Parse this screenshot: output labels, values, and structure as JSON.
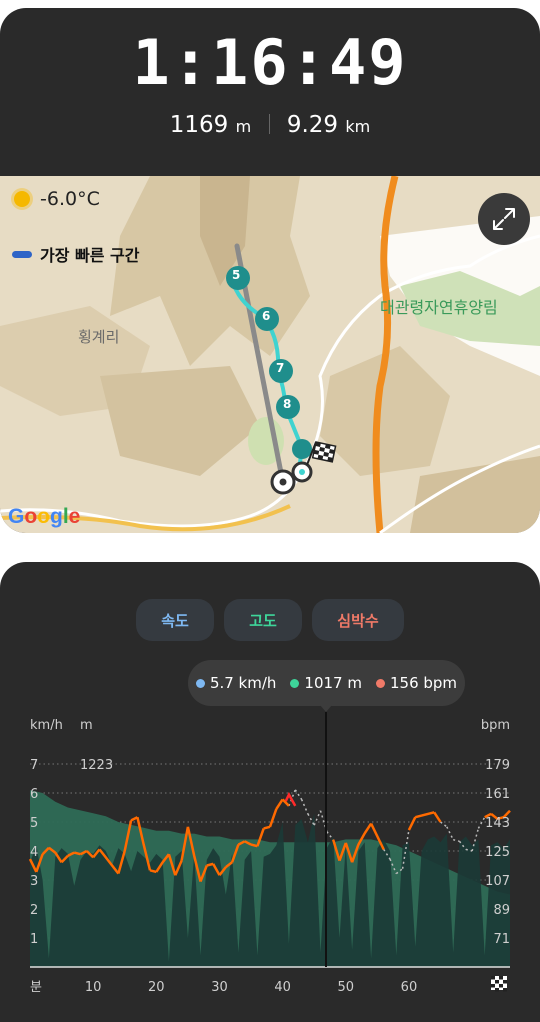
{
  "workout": {
    "duration": "1:16:49",
    "elevation_value": "1169",
    "elevation_unit": "m",
    "distance_value": "9.29",
    "distance_unit": "km"
  },
  "map": {
    "temperature": "-6.0°C",
    "legend_label": "가장 빠른 구간",
    "place_1": "대관령자연휴양림",
    "place_2": "횡계리",
    "attribution": "Google",
    "markers": [
      "5",
      "6",
      "7",
      "8"
    ],
    "route_color": "#3fd3d0",
    "fastest_color": "#2e64c7"
  },
  "chart_tabs": [
    {
      "label": "속도",
      "color": "#7eb8f2"
    },
    {
      "label": "고도",
      "color": "#3ed59a"
    },
    {
      "label": "심박수",
      "color": "#f07a68"
    }
  ],
  "tooltip": {
    "speed": "5.7 km/h",
    "altitude": "1017 m",
    "heart_rate": "156 bpm"
  },
  "chart_data": {
    "type": "area",
    "xlabel": "분",
    "x_ticks": [
      "10",
      "20",
      "30",
      "40",
      "50",
      "60"
    ],
    "xlim": [
      0,
      76
    ],
    "y_left_unit": "km/h",
    "y_left_ticks": [
      "7",
      "6",
      "5",
      "4",
      "3",
      "2",
      "1"
    ],
    "y_left_range": [
      0,
      7
    ],
    "y_altitude_unit": "m",
    "y_altitude_ticks": [
      "1223"
    ],
    "y_right_unit": "bpm",
    "y_right_ticks": [
      "179",
      "161",
      "143",
      "125",
      "107",
      "89",
      "71"
    ],
    "y_right_range": [
      53,
      179
    ],
    "series": [
      {
        "name": "고도",
        "color": "#3ed59a",
        "x": [
          0,
          2,
          4,
          6,
          8,
          10,
          12,
          14,
          16,
          18,
          20,
          22,
          24,
          26,
          28,
          30,
          32,
          34,
          36,
          38,
          40,
          42,
          44,
          46,
          48,
          50,
          52,
          54,
          56,
          58,
          60,
          62,
          64,
          66,
          68,
          70,
          72,
          74,
          76
        ],
        "values": [
          6.1,
          6.0,
          5.7,
          5.5,
          5.4,
          5.3,
          5.2,
          5.0,
          4.9,
          4.8,
          4.7,
          4.7,
          4.6,
          4.6,
          4.5,
          4.5,
          4.4,
          4.4,
          4.4,
          4.3,
          4.3,
          4.3,
          4.3,
          4.3,
          4.3,
          4.4,
          4.4,
          4.4,
          4.3,
          4.2,
          4.0,
          3.8,
          3.6,
          3.4,
          3.2,
          3.0,
          2.8,
          2.6,
          2.5
        ]
      },
      {
        "name": "속도",
        "color": "#1b3a36",
        "x": [
          0,
          1,
          2,
          3,
          4,
          5,
          6,
          7,
          8,
          9,
          10,
          11,
          12,
          13,
          14,
          15,
          16,
          17,
          18,
          19,
          20,
          21,
          22,
          23,
          24,
          25,
          26,
          27,
          28,
          29,
          30,
          31,
          32,
          33,
          34,
          35,
          36,
          37,
          38,
          39,
          40,
          41,
          42,
          43,
          44,
          45,
          46,
          47,
          48,
          49,
          50,
          51,
          52,
          53,
          54,
          55,
          56,
          57,
          58,
          59,
          60,
          61,
          62,
          63,
          64,
          65,
          66,
          67,
          68,
          69,
          70,
          71,
          72,
          73,
          74,
          75,
          76
        ],
        "values": [
          3.6,
          4.2,
          3.0,
          0.3,
          3.8,
          4.1,
          3.9,
          2.8,
          3.7,
          4.0,
          3.9,
          4.2,
          4.0,
          3.5,
          4.1,
          3.9,
          3.3,
          4.0,
          3.8,
          3.6,
          3.9,
          3.7,
          0.2,
          3.8,
          4.0,
          1.0,
          3.9,
          0.4,
          3.7,
          4.1,
          3.8,
          2.5,
          3.9,
          0.5,
          3.7,
          4.0,
          0.4,
          3.8,
          3.9,
          4.2,
          5.0,
          0.8,
          4.9,
          5.1,
          4.3,
          5.3,
          0.5,
          4.1,
          4.5,
          1.0,
          4.2,
          0.6,
          4.0,
          4.3,
          0.3,
          4.1,
          4.4,
          4.0,
          0.4,
          4.2,
          4.3,
          0.7,
          4.0,
          4.4,
          4.5,
          4.3,
          4.6,
          0.5,
          4.3,
          4.5,
          4.2,
          4.4,
          0.4,
          4.2,
          4.3,
          4.1,
          4.4
        ]
      },
      {
        "name": "심박수",
        "color": "#ff6a00",
        "x": [
          0,
          1,
          2,
          3,
          4,
          5,
          6,
          7,
          8,
          9,
          10,
          11,
          12,
          13,
          14,
          15,
          16,
          17,
          18,
          19,
          20,
          21,
          22,
          23,
          24,
          25,
          26,
          27,
          28,
          29,
          30,
          31,
          32,
          33,
          34,
          35,
          36,
          37,
          38,
          39,
          40,
          41,
          42,
          43,
          44,
          45,
          46,
          47,
          48,
          49,
          50,
          51,
          52,
          53,
          54,
          55,
          56,
          57,
          58,
          59,
          60,
          61,
          62,
          63,
          64,
          65,
          66,
          67,
          68,
          69,
          70,
          71,
          72,
          73,
          74,
          75,
          76
        ],
        "values": [
          120,
          112,
          123,
          127,
          124,
          118,
          122,
          124,
          123,
          125,
          121,
          126,
          121,
          116,
          111,
          125,
          144,
          146,
          129,
          113,
          112,
          118,
          123,
          110,
          119,
          140,
          122,
          106,
          116,
          117,
          110,
          115,
          118,
          129,
          131,
          129,
          128,
          139,
          140,
          151,
          157,
          153,
          163,
          157,
          148,
          141,
          150,
          137,
          132,
          119,
          130,
          118,
          129,
          136,
          142,
          134,
          126,
          120,
          111,
          114,
          138,
          146,
          147,
          148,
          149,
          143,
          140,
          132,
          131,
          126,
          125,
          139,
          146,
          148,
          145,
          146,
          150
        ],
        "gaps": [
          [
            41,
            48
          ],
          [
            56,
            60
          ],
          [
            65,
            72
          ]
        ]
      }
    ]
  }
}
